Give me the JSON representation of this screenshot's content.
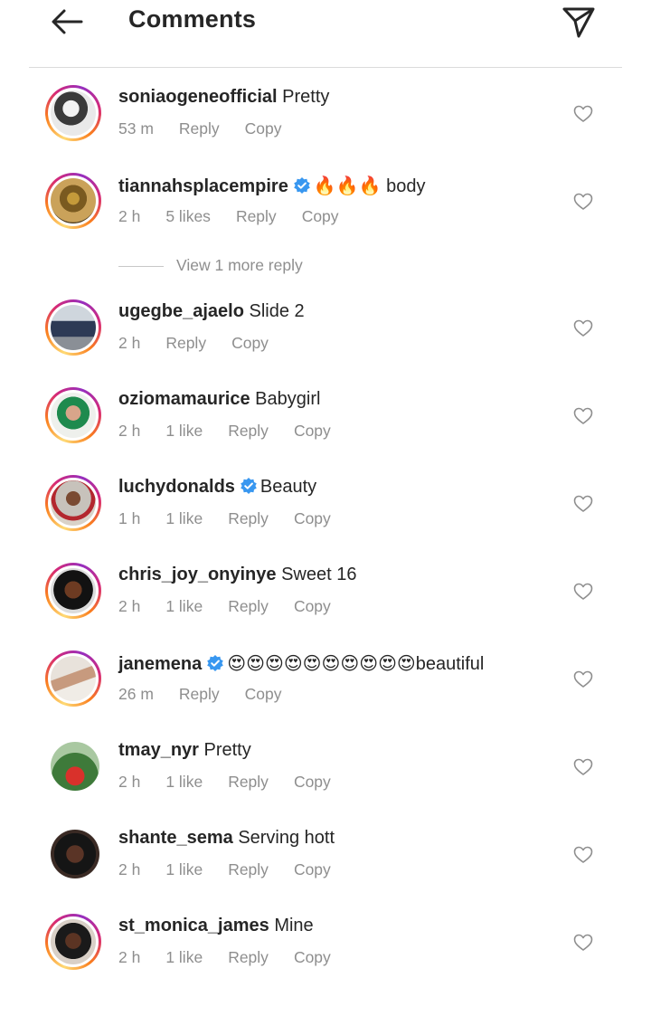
{
  "header": {
    "title": "Comments",
    "back_icon": "arrow-left-icon",
    "send_icon": "paper-plane-icon"
  },
  "view_more_replies": "View 1 more reply",
  "comments": [
    {
      "username": "soniaogeneofficial",
      "verified": false,
      "text": "Pretty",
      "time": "53 m",
      "likes": "",
      "reply": "Reply",
      "copy": "Copy"
    },
    {
      "username": "tiannahsplacempire",
      "verified": true,
      "text": "🔥🔥🔥 body",
      "time": "2 h",
      "likes": "5 likes",
      "reply": "Reply",
      "copy": "Copy"
    },
    {
      "username": "ugegbe_ajaelo",
      "verified": false,
      "text": "Slide 2",
      "time": "2 h",
      "likes": "",
      "reply": "Reply",
      "copy": "Copy"
    },
    {
      "username": "oziomamaurice",
      "verified": false,
      "text": "Babygirl",
      "time": "2 h",
      "likes": "1 like",
      "reply": "Reply",
      "copy": "Copy"
    },
    {
      "username": "luchydonalds",
      "verified": true,
      "text": "Beauty",
      "time": "1 h",
      "likes": "1 like",
      "reply": "Reply",
      "copy": "Copy"
    },
    {
      "username": "chris_joy_onyinye",
      "verified": false,
      "text": "Sweet 16",
      "time": "2 h",
      "likes": "1 like",
      "reply": "Reply",
      "copy": "Copy"
    },
    {
      "username": "janemena",
      "verified": true,
      "text": "😍😍😍😍😍😍😍😍😍😍beautiful",
      "time": "26 m",
      "likes": "",
      "reply": "Reply",
      "copy": "Copy"
    },
    {
      "username": "tmay_nyr",
      "verified": false,
      "text": "Pretty",
      "time": "2 h",
      "likes": "1 like",
      "reply": "Reply",
      "copy": "Copy"
    },
    {
      "username": "shante_sema",
      "verified": false,
      "text": "Serving hott",
      "time": "2 h",
      "likes": "1 like",
      "reply": "Reply",
      "copy": "Copy"
    },
    {
      "username": "st_monica_james",
      "verified": false,
      "text": "Mine",
      "time": "2 h",
      "likes": "1 like",
      "reply": "Reply",
      "copy": "Copy"
    }
  ],
  "colors": {
    "verified_badge": "#3897f0",
    "secondary_text": "#8e8e8e",
    "primary_text": "#262626"
  }
}
